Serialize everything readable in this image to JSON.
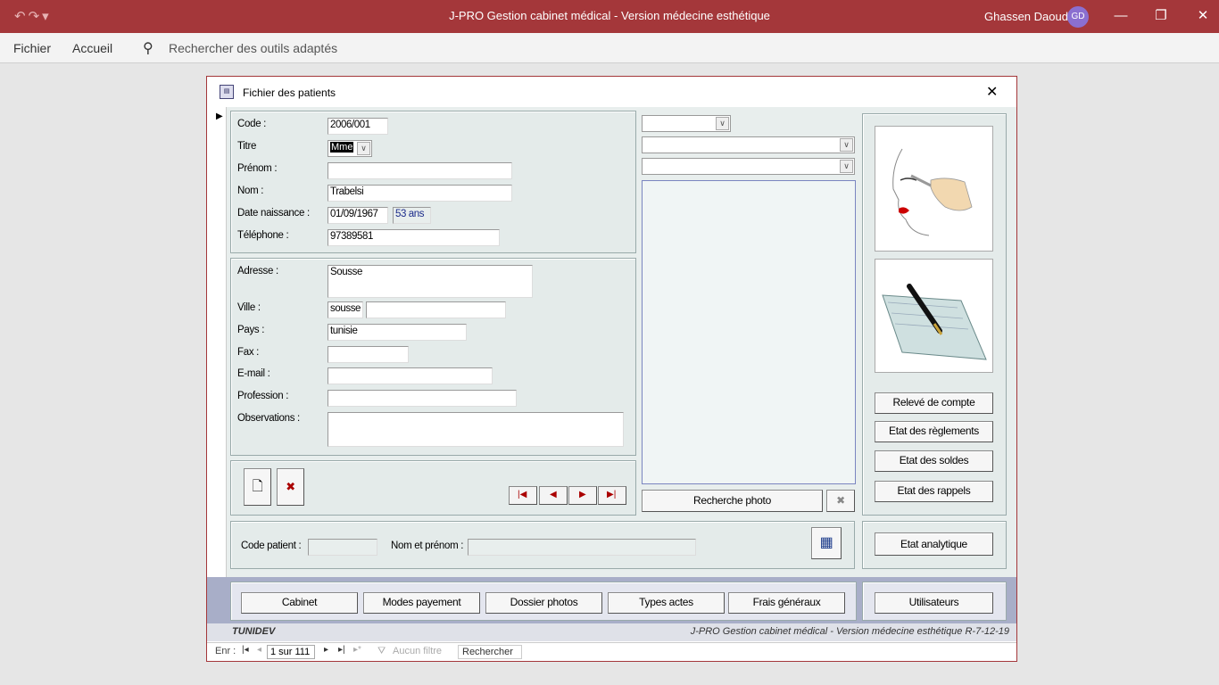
{
  "app": {
    "title": "J-PRO Gestion cabinet médical - Version médecine esthétique",
    "user_name": "Ghassen Daoud",
    "user_initials": "GD"
  },
  "menu": {
    "file": "Fichier",
    "home": "Accueil",
    "search_placeholder": "Rechercher des outils adaptés"
  },
  "form": {
    "title": "Fichier des patients",
    "fields": {
      "code_label": "Code :",
      "code": "2006/001",
      "titre_label": "Titre",
      "titre": "Mme",
      "prenom_label": "Prénom :",
      "prenom": "",
      "nom_label": "Nom :",
      "nom": "Trabelsi",
      "dob_label": "Date naissance :",
      "dob": "01/09/1967",
      "age": "53 ans",
      "tel_label": "Téléphone :",
      "tel": "97389581",
      "adresse_label": "Adresse :",
      "adresse": "Sousse",
      "ville_label": "Ville :",
      "ville_code": "sousse",
      "ville": "",
      "pays_label": "Pays :",
      "pays": "tunisie",
      "fax_label": "Fax :",
      "fax": "",
      "email_label": "E-mail :",
      "email": "",
      "profession_label": "Profession :",
      "profession": "",
      "observations_label": "Observations :",
      "observations": ""
    },
    "search": {
      "code_label": "Code patient :",
      "code": "",
      "name_label": "Nom et prénom :",
      "name": ""
    },
    "photo_search": "Recherche photo",
    "side_buttons": [
      "Relevé de compte",
      "Etat des règlements",
      "Etat des soldes",
      "Etat des rappels"
    ],
    "analytics_button": "Etat analytique",
    "bottom_buttons": [
      "Cabinet",
      "Modes payement",
      "Dossier photos",
      "Types actes",
      "Frais généraux"
    ],
    "users_button": "Utilisateurs",
    "footer_left": "TUNIDEV",
    "footer_right": "J-PRO Gestion cabinet médical - Version médecine esthétique R-7-12-19"
  },
  "record_nav": {
    "prefix": "Enr :",
    "position": "1 sur 111",
    "filter": "Aucun filtre",
    "search": "Rechercher"
  },
  "icons": {
    "undo": "undo-icon",
    "redo": "redo-icon",
    "search": "search-icon",
    "close": "close-icon",
    "form": "form-icon",
    "new": "new-record-icon",
    "delete": "delete-record-icon",
    "calendar": "calendar-icon"
  }
}
